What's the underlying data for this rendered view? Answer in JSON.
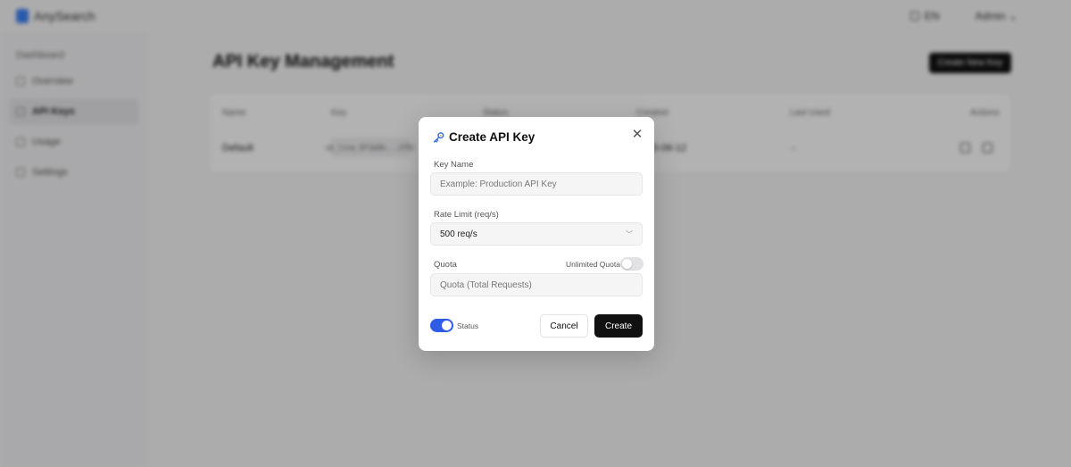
{
  "app": {
    "name": "AnySearch",
    "language": "EN",
    "user": "Admin"
  },
  "sidebar": {
    "heading": "Dashboard",
    "items": [
      {
        "label": "Overview",
        "icon": "grid-icon"
      },
      {
        "label": "API Keys",
        "icon": "key-icon",
        "active": true
      },
      {
        "label": "Usage",
        "icon": "chart-icon"
      },
      {
        "label": "Settings",
        "icon": "gear-icon"
      }
    ]
  },
  "page": {
    "title": "API Key Management",
    "create_button": "Create New Key"
  },
  "table": {
    "columns": [
      "Name",
      "Key",
      "Status",
      "Created",
      "Last Used",
      "Actions"
    ],
    "rows": [
      {
        "name": "Default",
        "key": "sk_live_8f3a9b...2f5C",
        "created": "2025-06-12",
        "last_used": "-"
      }
    ]
  },
  "modal": {
    "title": "Create API Key",
    "title_icon": "key-icon",
    "key_name_label": "Key Name",
    "key_name_placeholder": "Example: Production API Key",
    "rate_limit_label": "Rate Limit (req/s)",
    "rate_limit_value": "500 req/s",
    "quota_label": "Quota",
    "unlimited_label": "Unlimited Quota",
    "unlimited_on": false,
    "quota_placeholder": "Quota (Total Requests)",
    "status_label": "Status",
    "status_on": true,
    "cancel_label": "Cancel",
    "create_label": "Create"
  },
  "colors": {
    "primary": "#111111",
    "toggle_on": "#2f5ce6",
    "toggle_off": "#e2e2e5",
    "overlay": "rgba(0,0,0,0.30)"
  }
}
